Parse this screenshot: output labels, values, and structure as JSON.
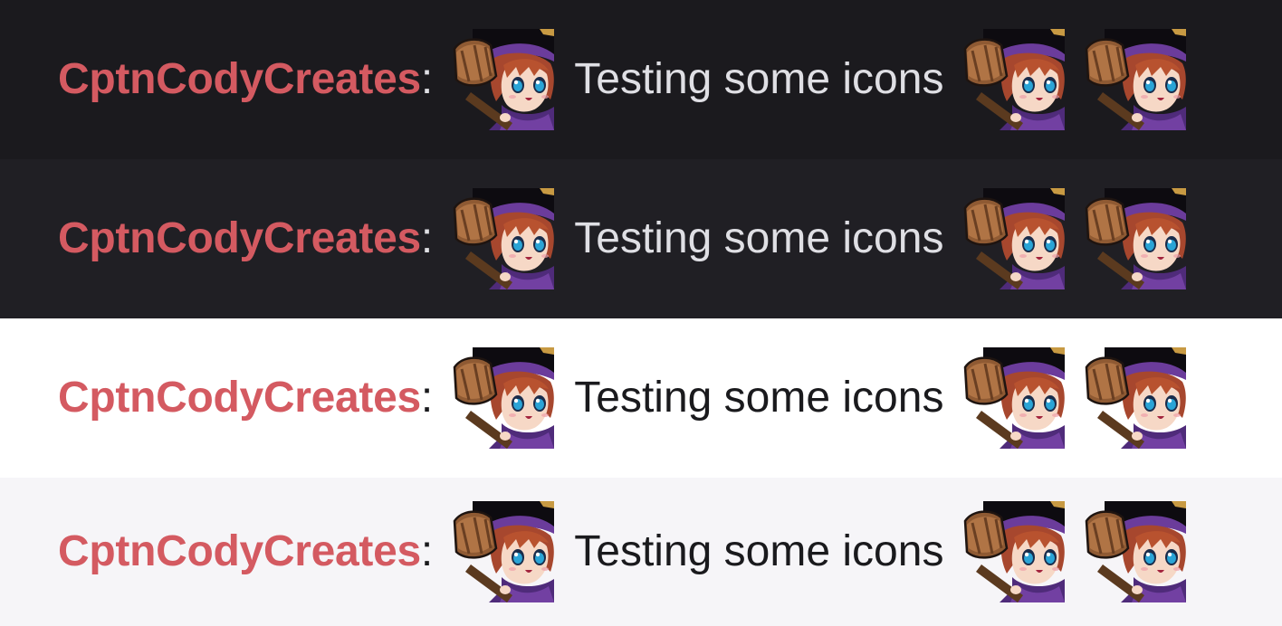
{
  "rows": [
    {
      "theme": "dark-1",
      "bg": "#1b1a1e",
      "text_color": "#dfdfe4",
      "username": "CptnCodyCreates",
      "separator": ":",
      "message": "Testing some icons"
    },
    {
      "theme": "dark-2",
      "bg": "#201f24",
      "text_color": "#dfdfe4",
      "username": "CptnCodyCreates",
      "separator": ":",
      "message": "Testing some icons"
    },
    {
      "theme": "light-1",
      "bg": "#ffffff",
      "text_color": "#1a1a1d",
      "username": "CptnCodyCreates",
      "separator": ":",
      "message": "Testing some icons"
    },
    {
      "theme": "light-2",
      "bg": "#f6f5f8",
      "text_color": "#1a1a1d",
      "username": "CptnCodyCreates",
      "separator": ":",
      "message": "Testing some icons"
    }
  ],
  "username_color": "#d45a61",
  "emote_name": "hammer-witch-emote-icon"
}
